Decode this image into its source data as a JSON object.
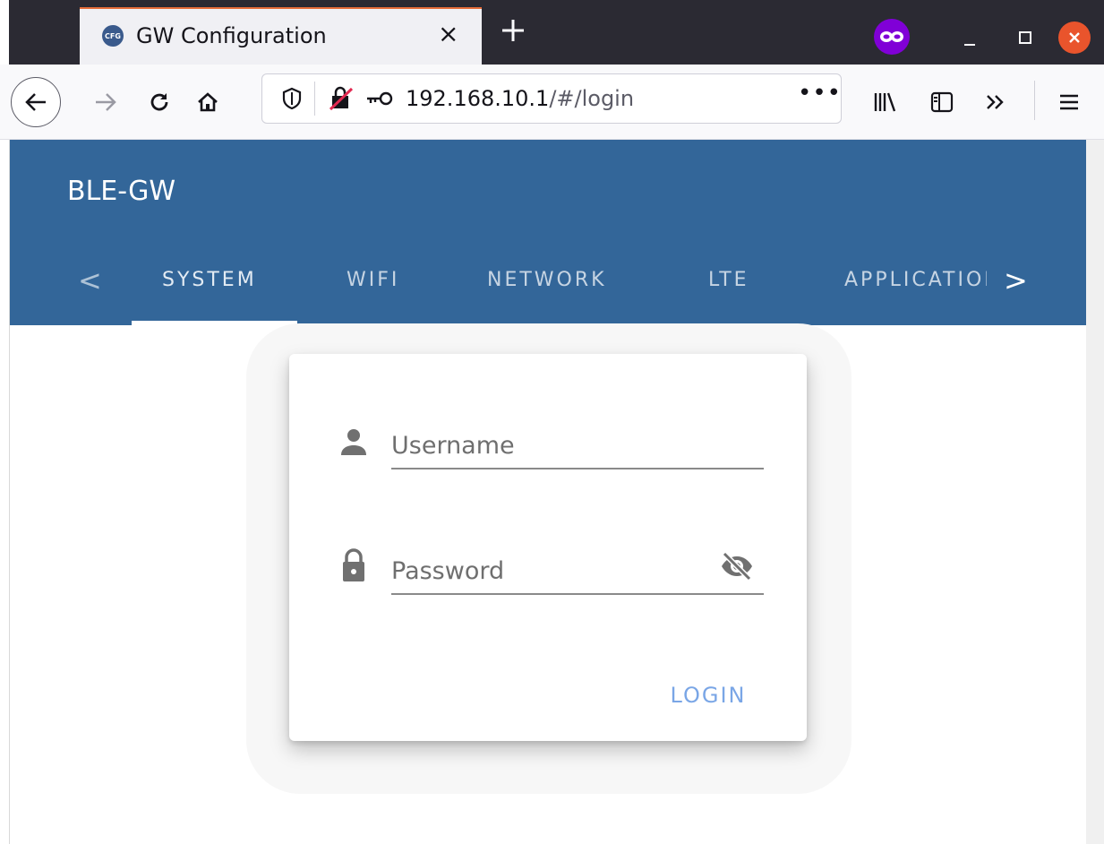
{
  "browser": {
    "tab_title": "GW Configuration",
    "tab_favicon_text": "CFG",
    "url_host": "192.168.10.1",
    "url_path": "/#/login",
    "url_more": "•••"
  },
  "app": {
    "brand": "BLE-GW",
    "tabs": [
      {
        "label": "SYSTEM",
        "active": true
      },
      {
        "label": "WIFI",
        "active": false
      },
      {
        "label": "NETWORK",
        "active": false
      },
      {
        "label": "LTE",
        "active": false
      },
      {
        "label": "APPLICATION",
        "active": false
      }
    ],
    "tabs_prev": "<",
    "tabs_next": ">"
  },
  "login": {
    "username_placeholder": "Username",
    "password_placeholder": "Password",
    "login_label": "LOGIN"
  },
  "colors": {
    "appbar": "#336699",
    "login_text": "#7aa6e6",
    "private_badge": "#8000d7",
    "close_button": "#e9542c"
  }
}
